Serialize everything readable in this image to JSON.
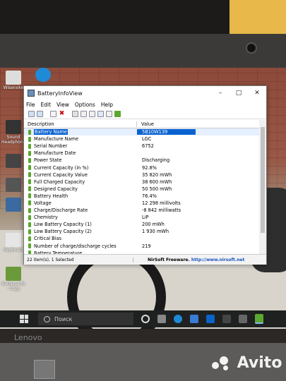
{
  "window": {
    "title": "BatteryInfoView",
    "menu": [
      "File",
      "Edit",
      "View",
      "Options",
      "Help"
    ],
    "columns": {
      "description": "Description",
      "value": "Value"
    },
    "rows": [
      {
        "d": "Battery Name",
        "v": "5B10W139",
        "selected": true
      },
      {
        "d": "Manufacture Name",
        "v": "LGC"
      },
      {
        "d": "Serial Number",
        "v": "6752"
      },
      {
        "d": "Manufacture Date",
        "v": ""
      },
      {
        "d": "Power State",
        "v": "Discharging"
      },
      {
        "d": "Current Capacity (in %)",
        "v": "92.8%"
      },
      {
        "d": "Current Capacity Value",
        "v": "35 820 mWh"
      },
      {
        "d": "Full Charged Capacity",
        "v": "38 600 mWh"
      },
      {
        "d": "Designed Capacity",
        "v": "50 500 mWh"
      },
      {
        "d": "Battery Health",
        "v": "76.4%"
      },
      {
        "d": "Voltage",
        "v": "12 298 millivolts"
      },
      {
        "d": "Charge/Discharge Rate",
        "v": "-8 842 milliwatts"
      },
      {
        "d": "Chemistry",
        "v": "LiP"
      },
      {
        "d": "Low Battery Capacity (1)",
        "v": "200 mWh"
      },
      {
        "d": "Low Battery Capacity (2)",
        "v": "1 930 mWh"
      },
      {
        "d": "Critical Bias",
        "v": ""
      },
      {
        "d": "Number of charge/discharge cycles",
        "v": "219"
      },
      {
        "d": "Battery Temperature",
        "v": ""
      }
    ],
    "status": {
      "items": "22 item(s), 1 Selected",
      "credit_prefix": "NirSoft Freeware.  ",
      "credit_url": "http://www.nirsoft.net"
    }
  },
  "desktop_icons": [
    "Wisenoke",
    "Sound Headphone",
    "",
    "",
    "",
    "Keyboard",
    "Batteryinfo - Copy"
  ],
  "taskbar": {
    "search_placeholder": "Поиск"
  },
  "laptop_brand": "Lenovo",
  "watermark": "Avito",
  "colors": {
    "accent": "#0a62d0",
    "battery_icon": "#5aa82e",
    "taskbar": "#1f2020"
  }
}
